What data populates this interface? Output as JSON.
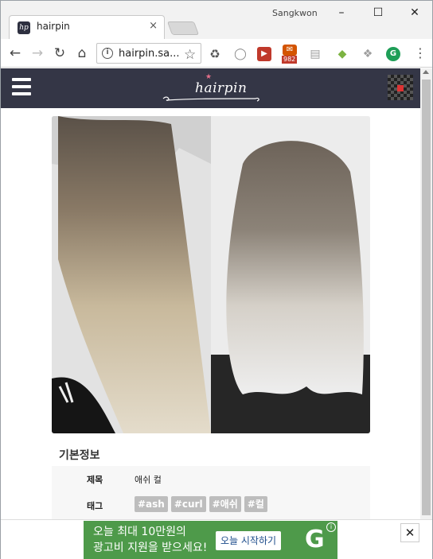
{
  "browser": {
    "profile_name": "Sangkwon",
    "tab_title": "hairpin",
    "tab_close": "×",
    "favicon_text": "hp",
    "window_controls": {
      "minimize": "–",
      "maximize": "☐",
      "close": "✕"
    },
    "nav": {
      "back": "←",
      "forward": "→",
      "reload": "↻",
      "home": "⌂"
    },
    "url": "hairpin.sa...",
    "info_icon": "i",
    "star": "☆",
    "extensions": [
      {
        "name": "recycle-icon",
        "glyph": "♻",
        "color": "#555555"
      },
      {
        "name": "circle-ext-icon",
        "glyph": "◯",
        "color": "#888888"
      },
      {
        "name": "forward-ext-icon",
        "glyph": "▶",
        "color": "#c0392b"
      },
      {
        "name": "mail-icon",
        "glyph": "✉",
        "color": "#d35400",
        "badge": "982"
      },
      {
        "name": "doc-ext-icon",
        "glyph": "▤",
        "color": "#9e9e9e"
      },
      {
        "name": "android-icon",
        "glyph": "◆",
        "color": "#7cb342"
      },
      {
        "name": "cube-ext-icon",
        "glyph": "❖",
        "color": "#9e9e9e"
      },
      {
        "name": "grammarly-icon",
        "glyph": "G",
        "color": "#1e9e57"
      }
    ],
    "menu": "⋮"
  },
  "site": {
    "logo_text": "hairpin",
    "logo_star": "★"
  },
  "content": {
    "section_title": "기본정보",
    "rows": [
      {
        "key": "제목",
        "value": "애쉬 컬"
      },
      {
        "key": "태그",
        "tags": [
          "#ash",
          "#curl",
          "#애쉬",
          "#컬"
        ]
      }
    ]
  },
  "ad": {
    "line1": "오늘 최대 10만원의",
    "line2": "광고비 지원을 받으세요!",
    "cta": "오늘 시작하기",
    "logo": "G",
    "info": "i",
    "close": "✕"
  }
}
